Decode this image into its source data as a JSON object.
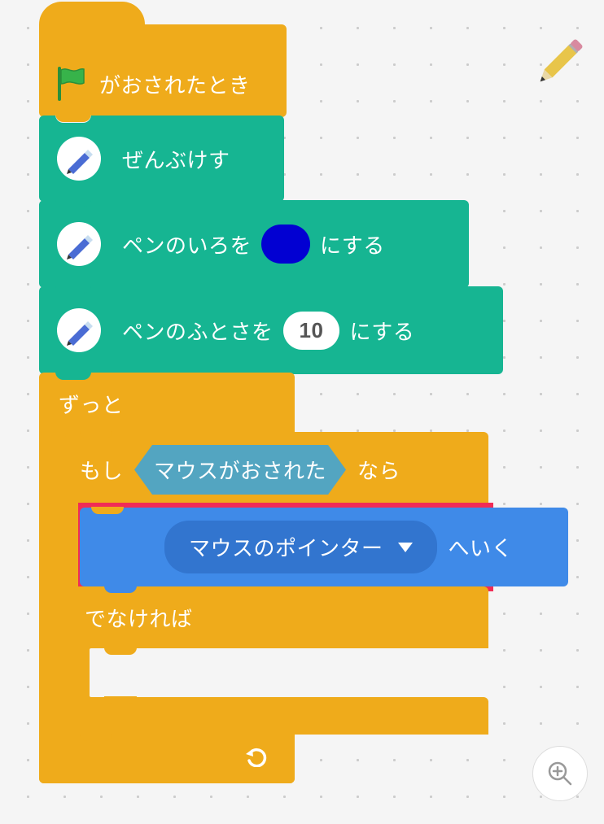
{
  "hat": {
    "label": "がおされたとき"
  },
  "pen": {
    "eraseAll": "ぜんぶけす",
    "setColorPrefix": "ペンのいろを",
    "setColorSuffix": "にする",
    "colorValue": "#0200d2",
    "setSizePrefix": "ペンのふとさを",
    "setSizeSuffix": "にする",
    "sizeValue": "10"
  },
  "control": {
    "forever": "ずっと",
    "if": "もし",
    "then": "なら",
    "else": "でなければ"
  },
  "sensing": {
    "mouseDown": "マウスがおされた"
  },
  "motion": {
    "gotoSuffix": "へいく",
    "targetOption": "マウスのポインター"
  },
  "icons": {
    "flag": "green-flag-icon",
    "pen": "pen-icon",
    "pencilTool": "pencil-tool-icon",
    "loopArrow": "loop-arrow-icon",
    "zoom": "zoom-in-icon"
  }
}
